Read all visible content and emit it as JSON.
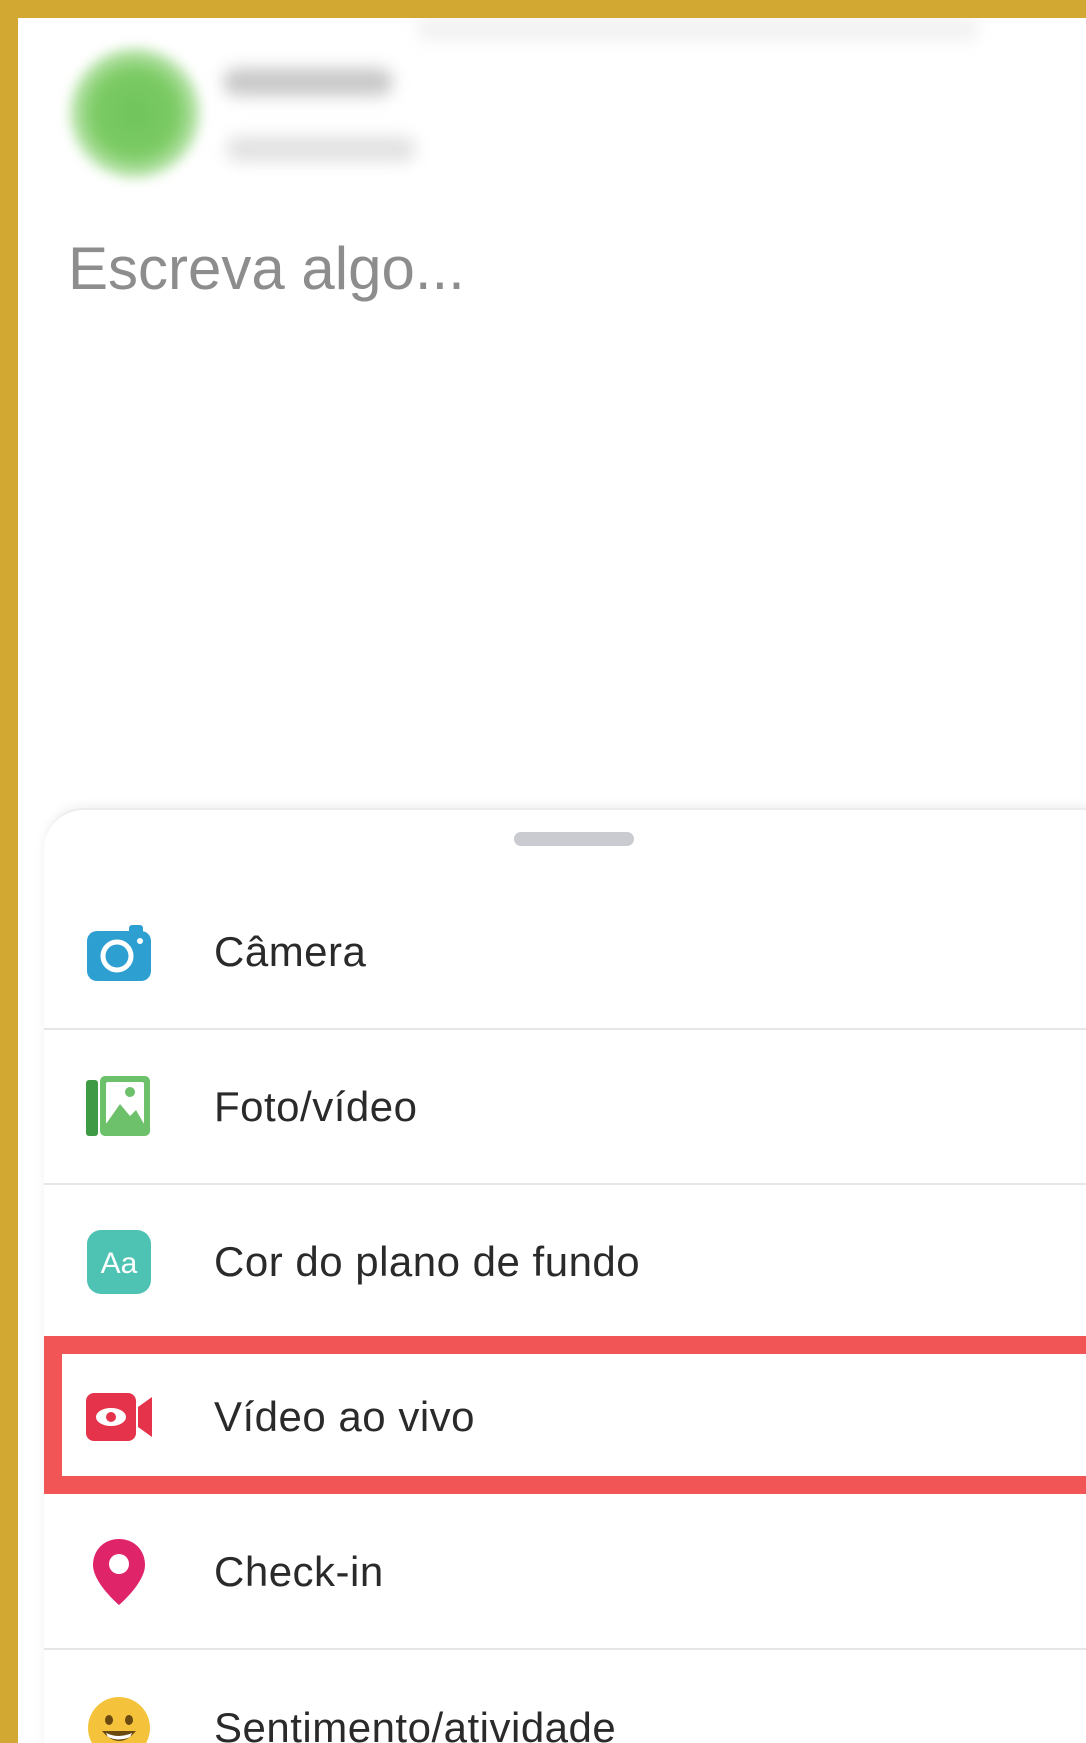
{
  "composer": {
    "placeholder": "Escreva algo..."
  },
  "sheet": {
    "items": [
      {
        "label": "Câmera",
        "icon": "camera-icon",
        "color": "#2d9fd0"
      },
      {
        "label": "Foto/vídeo",
        "icon": "photo-icon",
        "color": "#5bb85a"
      },
      {
        "label": "Cor do plano de fundo",
        "icon": "background-color-icon",
        "color": "#4fc3b3"
      },
      {
        "label": "Vídeo ao vivo",
        "icon": "live-video-icon",
        "color": "#e5334b"
      },
      {
        "label": "Check-in",
        "icon": "location-pin-icon",
        "color": "#e0246a"
      },
      {
        "label": "Sentimento/atividade",
        "icon": "smiley-icon",
        "color": "#f5c33b"
      }
    ],
    "highlight_color": "#f25555"
  }
}
